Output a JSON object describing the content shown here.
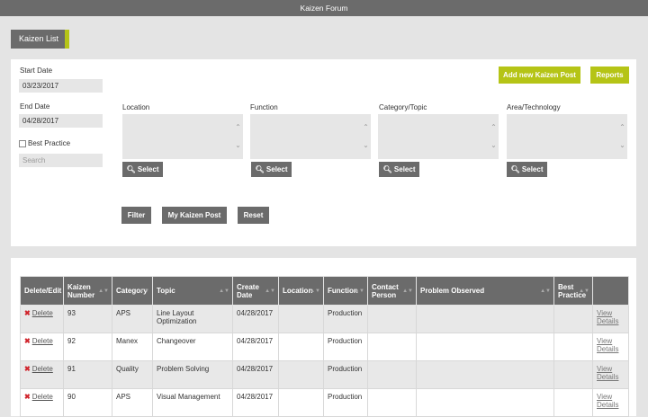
{
  "window": {
    "title": "Kaizen Forum"
  },
  "tab": {
    "label": "Kaizen List"
  },
  "filters": {
    "start_date_label": "Start Date",
    "start_date_value": "03/23/2017",
    "end_date_label": "End Date",
    "end_date_value": "04/28/2017",
    "best_practice_label": "Best Practice",
    "search_placeholder": "Search",
    "location_label": "Location",
    "function_label": "Function",
    "category_label": "Category/Topic",
    "area_label": "Area/Technology",
    "select_label": "Select",
    "filter_label": "Filter",
    "my_post_label": "My Kaizen Post",
    "reset_label": "Reset"
  },
  "actions": {
    "add_label": "Add new Kaizen Post",
    "reports_label": "Reports"
  },
  "colors": {
    "accent": "#b5c416",
    "header_gray": "#6b6b6b",
    "delete_red": "#d0242c"
  },
  "table": {
    "headers": [
      "Delete/Edit",
      "Kaizen Number",
      "Category",
      "Topic",
      "Create Date",
      "Location",
      "Function",
      "Contact Person",
      "Problem Observed",
      "Best Practice",
      ""
    ],
    "delete_label": "Delete",
    "view_label": "View Details",
    "rows": [
      {
        "number": "93",
        "category": "APS",
        "topic": "Line Layout Optimization",
        "date": "04/28/2017",
        "location": "",
        "function": "Production",
        "contact": "",
        "problem": "",
        "best": ""
      },
      {
        "number": "92",
        "category": "Manex",
        "topic": "Changeover",
        "date": "04/28/2017",
        "location": "",
        "function": "Production",
        "contact": "",
        "problem": "",
        "best": ""
      },
      {
        "number": "91",
        "category": "Quality",
        "topic": "Problem Solving",
        "date": "04/28/2017",
        "location": "",
        "function": "Production",
        "contact": "",
        "problem": "",
        "best": ""
      },
      {
        "number": "90",
        "category": "APS",
        "topic": "Visual Management",
        "date": "04/28/2017",
        "location": "",
        "function": "Production",
        "contact": "",
        "problem": "",
        "best": ""
      }
    ]
  }
}
